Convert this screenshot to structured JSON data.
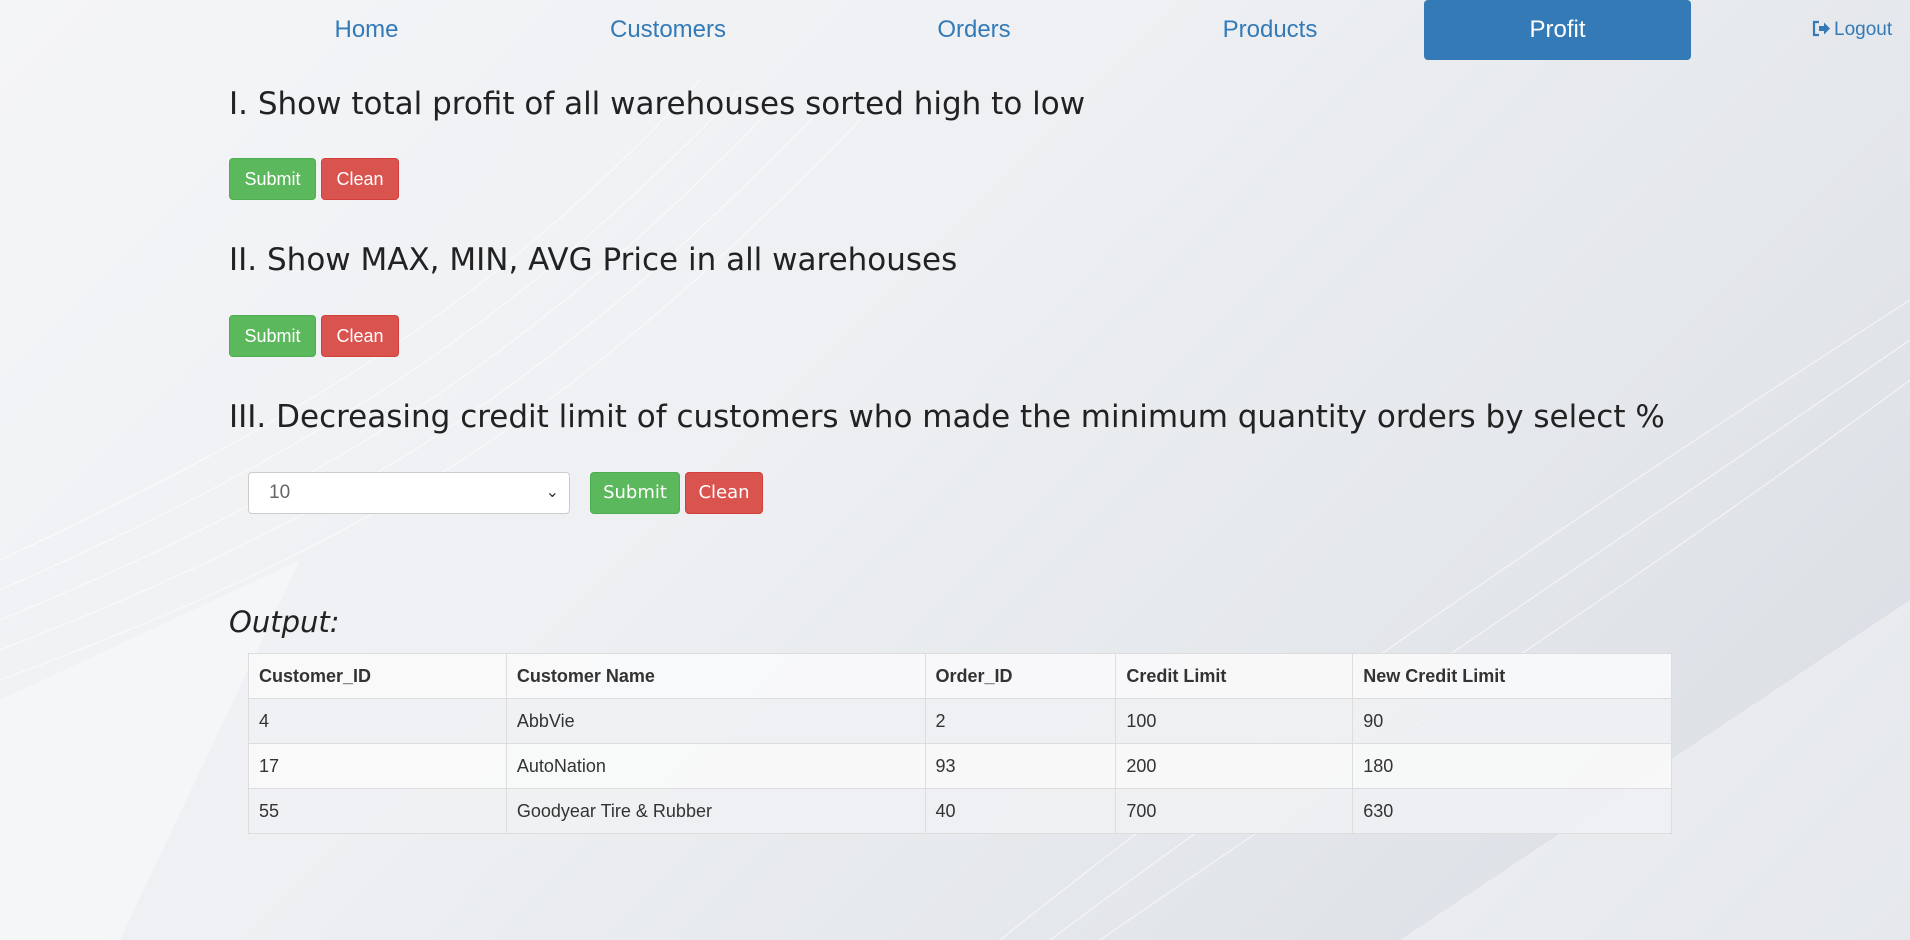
{
  "nav": {
    "items": [
      {
        "label": "Home"
      },
      {
        "label": "Customers"
      },
      {
        "label": "Orders"
      },
      {
        "label": "Products"
      },
      {
        "label": "Profit",
        "active": true
      }
    ],
    "logout_label": "Logout"
  },
  "sections": [
    {
      "title": "I. Show total profit of all warehouses sorted high to low",
      "submit_label": "Submit",
      "clean_label": "Clean"
    },
    {
      "title": "II. Show MAX, MIN, AVG Price in all warehouses",
      "submit_label": "Submit",
      "clean_label": "Clean"
    },
    {
      "title": "III. Decreasing credit limit of customers who made the minimum quantity orders by select %",
      "select_value": "10",
      "submit_label": "Submit",
      "clean_label": "Clean"
    }
  ],
  "output": {
    "label": "Output:",
    "columns": [
      "Customer_ID",
      "Customer Name",
      "Order_ID",
      "Credit Limit",
      "New Credit Limit"
    ],
    "rows": [
      [
        "4",
        "AbbVie",
        "2",
        "100",
        "90"
      ],
      [
        "17",
        "AutoNation",
        "93",
        "200",
        "180"
      ],
      [
        "55",
        "Goodyear Tire & Rubber",
        "40",
        "700",
        "630"
      ]
    ]
  },
  "colors": {
    "nav_active": "#337ab7",
    "link": "#337ab7",
    "submit": "#5cb85c",
    "clean": "#d9534f"
  }
}
